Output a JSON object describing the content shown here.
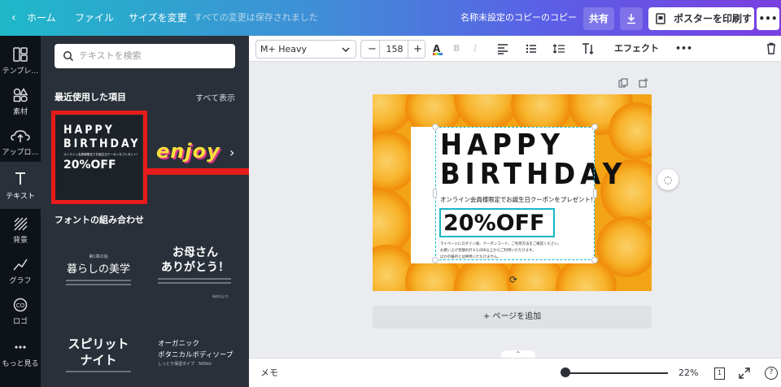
{
  "topbar": {
    "home": "ホーム",
    "file": "ファイル",
    "resize": "サイズを変更",
    "saved_status": "すべての変更は保存されました",
    "doc_title": "名称未設定のコピーのコピー",
    "share": "共有",
    "print_poster": "ポスターを印刷する",
    "more": "•••"
  },
  "rail": {
    "items": [
      {
        "label": "テンプレ…",
        "icon": "template-icon"
      },
      {
        "label": "素材",
        "icon": "elements-icon"
      },
      {
        "label": "アップロ…",
        "icon": "upload-icon"
      },
      {
        "label": "テキスト",
        "icon": "text-icon"
      },
      {
        "label": "背景",
        "icon": "background-icon"
      },
      {
        "label": "グラフ",
        "icon": "chart-icon"
      },
      {
        "label": "ロゴ",
        "icon": "logo-icon"
      },
      {
        "label": "もっと見る",
        "icon": "more-icon"
      }
    ]
  },
  "panel": {
    "search_placeholder": "テキストを検索",
    "recent_title": "最近使用した項目",
    "see_all": "すべて表示",
    "recent_hb": {
      "line1": "HAPPY",
      "line2": "BIRTHDAY",
      "sub": "オンライン会員様限定でお誕生日クーポンをプレゼント！",
      "off": "20%OFF"
    },
    "recent_enjoy": "enjoy",
    "combos_title": "フォントの組み合わせ",
    "combo1_small": "第1章の始",
    "combo1_title": "暮らしの美学",
    "combo2_line1": "お母さん",
    "combo2_line2": "ありがとう！",
    "combo2_sign": "母の日より",
    "combo3_line1": "スピリット",
    "combo3_line2": "ナイト",
    "combo4_line1": "オーガニック",
    "combo4_line2": "ボタニカルボディソープ",
    "combo4_line3": "しっとり保湿タイプ　500ml"
  },
  "toolbar": {
    "font": "M+ Heavy",
    "minus": "−",
    "size": "158",
    "plus": "+",
    "text_color": "A",
    "bold": "B",
    "italic": "I",
    "effect": "エフェクト",
    "more": "•••"
  },
  "design": {
    "line1": "HAPPY",
    "line2": "BIRTHDAY",
    "sub": "オンライン会員様限定でお誕生日クーポンをプレゼント！",
    "off": "20%OFF",
    "fine1": "マイページにログイン後、クーポンコード、ご利用方法をご確認ください。",
    "fine2": "お買い上げ金額の計￥3,000以上からご利用いただけます。",
    "fine3": "ほかの優待とは併用いただけません。",
    "add_page": "+ ページを追加"
  },
  "bottombar": {
    "notes": "メモ",
    "zoom": "22%",
    "page_count": "1",
    "help": "?"
  },
  "colors": {
    "accent": "#17b9c6",
    "annotation_red": "#e81b1b",
    "dark_panel": "#293039"
  }
}
